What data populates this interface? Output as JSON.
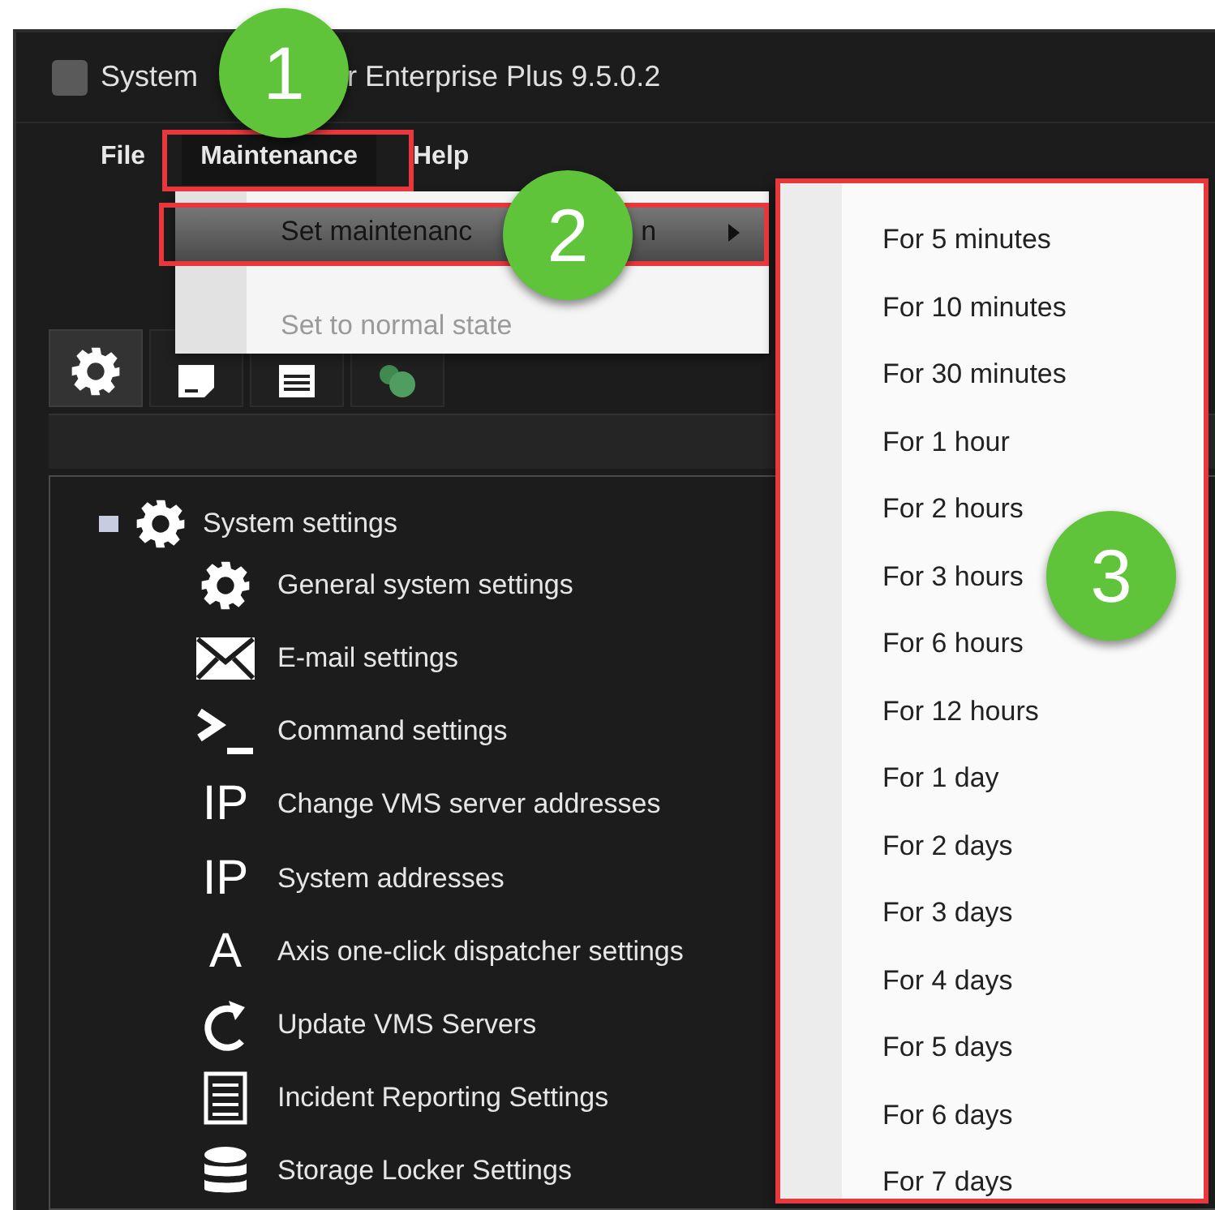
{
  "window": {
    "title_parts": [
      "System",
      "r Enterprise Plus 9.5.0.2"
    ]
  },
  "menu_bar": [
    {
      "label": "File",
      "selected": false
    },
    {
      "label": "Maintenance",
      "selected": true
    },
    {
      "label": "Help",
      "selected": false
    }
  ],
  "maintenance_menu": [
    {
      "label_parts": [
        "Set maintenanc",
        "n"
      ],
      "selected": true,
      "disabled": false,
      "has_submenu": true
    },
    {
      "label_parts": [
        "Set to normal state"
      ],
      "selected": false,
      "disabled": true,
      "has_submenu": false
    }
  ],
  "toolbar_tabs": [
    {
      "kind": "gear",
      "selected": true
    },
    {
      "kind": "document",
      "selected": false
    },
    {
      "kind": "list",
      "selected": false
    },
    {
      "kind": "people",
      "selected": false
    }
  ],
  "tree": {
    "label": "System settings",
    "kind": "gear",
    "expanded": true,
    "children": [
      {
        "label": "General system settings",
        "kind": "gear"
      },
      {
        "label": "E-mail settings",
        "kind": "mail"
      },
      {
        "label": "Command settings",
        "kind": "terminal"
      },
      {
        "label": "Change VMS server addresses",
        "kind": "glyph",
        "glyph": "IP"
      },
      {
        "label": "System addresses",
        "kind": "glyph",
        "glyph": "IP"
      },
      {
        "label": "Axis one-click dispatcher settings",
        "kind": "glyph",
        "glyph": "A"
      },
      {
        "label": "Update VMS Servers",
        "kind": "refresh"
      },
      {
        "label": "Incident Reporting Settings",
        "kind": "list"
      },
      {
        "label": "Storage Locker Settings",
        "kind": "database"
      }
    ]
  },
  "submenu": [
    "For 5 minutes",
    "For 10 minutes",
    "For 30 minutes",
    "For 1 hour",
    "For 2 hours",
    "For 3 hours",
    "For 6 hours",
    "For 12 hours",
    "For 1 day",
    "For 2 days",
    "For 3 days",
    "For 4 days",
    "For 5 days",
    "For 6 days",
    "For 7 days"
  ],
  "callouts": [
    "1",
    "2",
    "3"
  ]
}
